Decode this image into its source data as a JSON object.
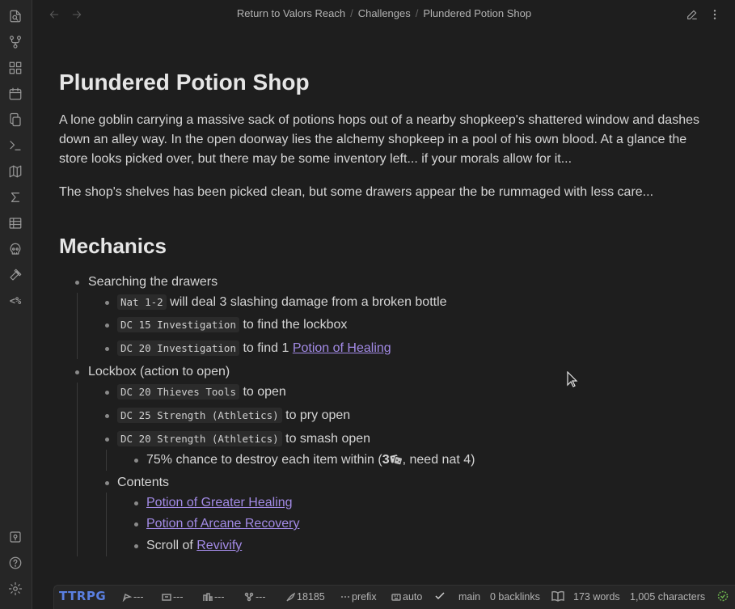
{
  "ribbon": {
    "icons": [
      "open-file-icon",
      "graph-view-icon",
      "canvas-icon",
      "daily-note-icon",
      "copy-icon",
      "command-palette-icon",
      "map-icon",
      "sum-icon",
      "table-icon",
      "skull-icon",
      "hammer-icon",
      "templater-icon",
      "vault-icon",
      "help-icon",
      "settings-icon"
    ],
    "templater_label": "<%"
  },
  "header": {
    "breadcrumbs": [
      "Return to Valors Reach",
      "Challenges",
      "Plundered Potion Shop"
    ]
  },
  "note": {
    "title": "Plundered Potion Shop",
    "intro": "A lone goblin carrying a massive sack of potions hops out of a nearby shopkeep's shattered window and dashes down an alley way. In the open doorway lies the alchemy shopkeep in a pool of his own blood. At a glance the store looks picked over, but there may be some inventory left... if your morals allow for it...",
    "intro2": "The shop's shelves has been picked clean, but some drawers appear the be rummaged with less care...",
    "mechanics_heading": "Mechanics",
    "list": {
      "searching": "Searching the drawers",
      "nat12_code": "Nat 1-2",
      "nat12_text": " will deal 3 slashing damage from a broken bottle",
      "dc15_code": "DC 15 Investigation",
      "dc15_text": " to find the lockbox",
      "dc20_code": "DC 20 Investigation",
      "dc20_text": " to find 1 ",
      "healing_link": "Potion of Healing",
      "lockbox": "Lockbox (action to open)",
      "thieves_code": "DC 20 Thieves Tools",
      "thieves_text": " to open",
      "pry_code": "DC 25 Strength (Athletics)",
      "pry_text": " to pry open",
      "smash_code": "DC 20 Strength (Athletics)",
      "smash_text": " to smash open",
      "chance_text": "75% chance to destroy each item within (",
      "dice_count": "3",
      "chance_tail": ", need nat 4)",
      "contents": "Contents",
      "greater_link": "Potion of Greater Healing",
      "arcane_link": "Potion of Arcane Recovery",
      "scroll_text": "Scroll of ",
      "revivify_link": "Revivify"
    }
  },
  "status": {
    "plugin_label": "TTRPG",
    "stat1": "---",
    "stat2": "---",
    "stat3": "---",
    "stat4": "---",
    "count": "18185",
    "prefix": "prefix",
    "auto": "auto",
    "branch": "main",
    "backlinks": "0 backlinks",
    "words": "173 words",
    "chars": "1,005 characters"
  }
}
